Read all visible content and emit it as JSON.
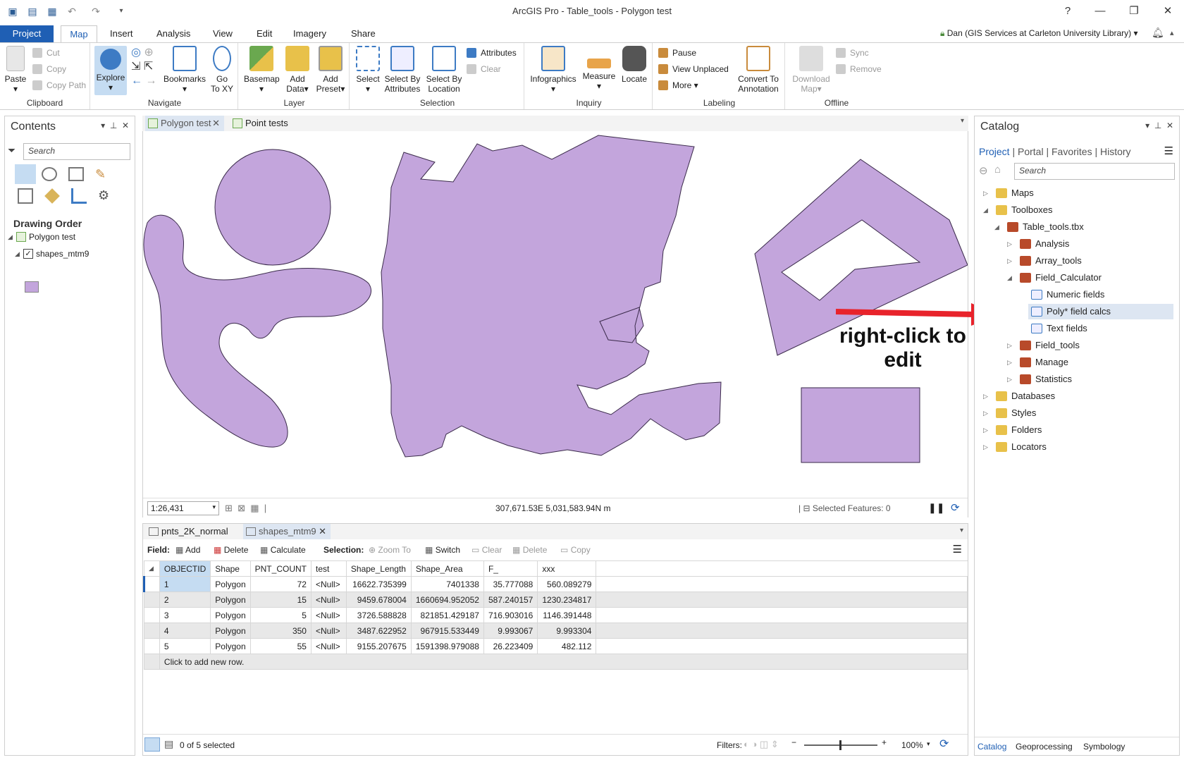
{
  "window": {
    "title": "ArcGIS Pro - Table_tools - Polygon test",
    "help": "?",
    "user": "Dan (GIS Services at Carleton University Library)"
  },
  "ribbon_tabs": [
    "Project",
    "Map",
    "Insert",
    "Analysis",
    "View",
    "Edit",
    "Imagery",
    "Share"
  ],
  "ribbon": {
    "clipboard": {
      "label": "Clipboard",
      "paste": "Paste",
      "cut": "Cut",
      "copy": "Copy",
      "copy_path": "Copy Path"
    },
    "navigate": {
      "label": "Navigate",
      "explore": "Explore",
      "bookmarks": "Bookmarks",
      "goto1": "Go",
      "goto2": "To XY"
    },
    "layer": {
      "label": "Layer",
      "basemap": "Basemap",
      "add1": "Add",
      "add2": "Data",
      "preset1": "Add",
      "preset2": "Preset"
    },
    "selection": {
      "label": "Selection",
      "select": "Select",
      "sba1": "Select By",
      "sba2": "Attributes",
      "sbl1": "Select By",
      "sbl2": "Location",
      "attributes": "Attributes",
      "clear": "Clear"
    },
    "inquiry": {
      "label": "Inquiry",
      "infographics": "Infographics",
      "measure": "Measure",
      "locate": "Locate"
    },
    "labeling": {
      "label": "Labeling",
      "pause": "Pause",
      "view_unplaced": "View Unplaced",
      "more": "More",
      "conv1": "Convert To",
      "conv2": "Annotation"
    },
    "offline": {
      "label": "Offline",
      "dl1": "Download",
      "dl2": "Map",
      "sync": "Sync",
      "remove": "Remove"
    }
  },
  "contents": {
    "title": "Contents",
    "search_placeholder": "Search",
    "drawing_order": "Drawing Order",
    "map_name": "Polygon test",
    "layer_name": "shapes_mtm9"
  },
  "map_tabs": [
    "Polygon test",
    "Point tests"
  ],
  "map_status": {
    "scale": "1:26,431",
    "coords": "307,671.53E 5,031,583.94N m",
    "selected": "Selected Features: 0"
  },
  "annotation": {
    "line1": "right-click to",
    "line2": "edit"
  },
  "table_tabs": [
    "pnts_2K_normal",
    "shapes_mtm9"
  ],
  "table_toolbar": {
    "field": "Field:",
    "add": "Add",
    "delete": "Delete",
    "calculate": "Calculate",
    "selection": "Selection:",
    "zoom_to": "Zoom To",
    "switch": "Switch",
    "clear": "Clear",
    "del2": "Delete",
    "copy": "Copy"
  },
  "table": {
    "columns": [
      "OBJECTID",
      "Shape",
      "PNT_COUNT",
      "test",
      "Shape_Length",
      "Shape_Area",
      "F_",
      "xxx"
    ],
    "rows": [
      [
        "1",
        "Polygon",
        "72",
        "<Null>",
        "16622.735399",
        "7401338",
        "35.777088",
        "560.089279"
      ],
      [
        "2",
        "Polygon",
        "15",
        "<Null>",
        "9459.678004",
        "1660694.952052",
        "587.240157",
        "1230.234817"
      ],
      [
        "3",
        "Polygon",
        "5",
        "<Null>",
        "3726.588828",
        "821851.429187",
        "716.903016",
        "1146.391448"
      ],
      [
        "4",
        "Polygon",
        "350",
        "<Null>",
        "3487.622952",
        "967915.533449",
        "9.993067",
        "9.993304"
      ],
      [
        "5",
        "Polygon",
        "55",
        "<Null>",
        "9155.207675",
        "1591398.979088",
        "26.223409",
        "482.112"
      ]
    ],
    "add_row": "Click to add new row.",
    "selected": "0 of 5 selected",
    "filters": "Filters:",
    "zoom": "100%"
  },
  "catalog": {
    "title": "Catalog",
    "tabs": [
      "Project",
      "Portal",
      "Favorites",
      "History"
    ],
    "search_placeholder": "Search",
    "tree": {
      "maps": "Maps",
      "toolboxes": "Toolboxes",
      "tbx": "Table_tools.tbx",
      "analysis": "Analysis",
      "array_tools": "Array_tools",
      "field_calculator": "Field_Calculator",
      "numeric": "Numeric fields",
      "poly": "Poly* field calcs",
      "text": "Text fields",
      "field_tools": "Field_tools",
      "manage": "Manage",
      "statistics": "Statistics",
      "databases": "Databases",
      "styles": "Styles",
      "folders": "Folders",
      "locators": "Locators"
    },
    "bottom_tabs": [
      "Catalog",
      "Geoprocessing",
      "Symbology"
    ]
  },
  "colors": {
    "accent": "#1f5fb4",
    "polygon_fill": "#c3a5dc",
    "arrow": "#e8232b"
  }
}
